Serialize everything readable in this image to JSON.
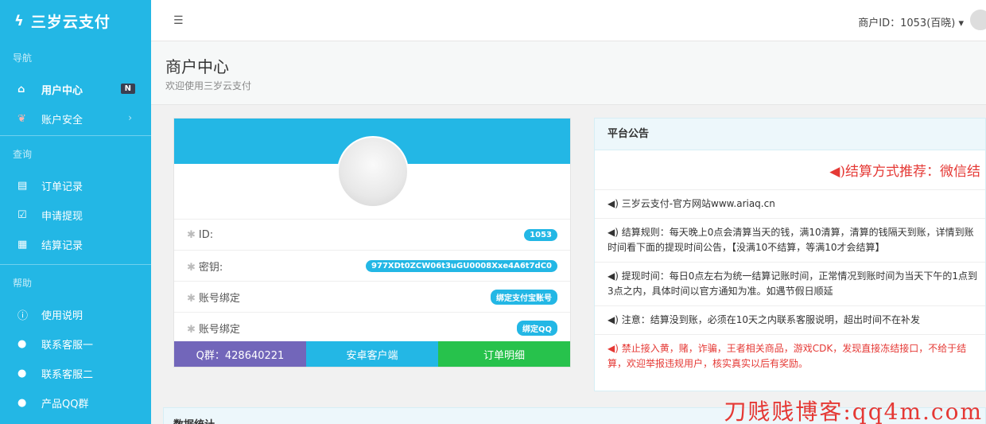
{
  "brand": {
    "name": "三岁云支付",
    "icon": "bolt-icon"
  },
  "sidebar": {
    "sections": [
      {
        "title": "导航"
      },
      {
        "title": "查询"
      },
      {
        "title": "帮助"
      }
    ],
    "nav": [
      {
        "label": "用户中心",
        "icon": "home-icon",
        "badge": "N"
      },
      {
        "label": "账户安全",
        "icon": "leaf-icon"
      },
      {
        "label": "订单记录",
        "icon": "list-icon"
      },
      {
        "label": "申请提现",
        "icon": "check-square-icon"
      },
      {
        "label": "结算记录",
        "icon": "grid-icon"
      },
      {
        "label": "使用说明",
        "icon": "info-icon"
      },
      {
        "label": "联系客服一",
        "icon": "user-icon"
      },
      {
        "label": "联系客服二",
        "icon": "user-icon"
      },
      {
        "label": "产品QQ群",
        "icon": "user-icon"
      }
    ]
  },
  "header": {
    "user_label": "商户ID：1053(百晓) ▾"
  },
  "page": {
    "title": "商户中心",
    "subtitle": "欢迎使用三岁云支付"
  },
  "profile": {
    "rows": [
      {
        "label": "ID:",
        "value": "1053"
      },
      {
        "label": "密钥:",
        "value": "977XDt0ZCW06t3uGU0008Xxe4A6t7dC0"
      },
      {
        "label": "账号绑定",
        "value": "绑定支付宝账号"
      },
      {
        "label": "账号绑定",
        "value": "绑定QQ"
      }
    ],
    "buttons": {
      "qq_group": "Q群：428640221",
      "android": "安卓客户端",
      "orders": "订单明细"
    }
  },
  "notice": {
    "title": "平台公告",
    "banner": "◀)结算方式推荐：微信结",
    "items": [
      "◀) 三岁云支付-官方网站www.ariaq.cn",
      "◀) 结算规则：每天晚上0点会清算当天的钱，满10清算，清算的钱隔天到账，详情到账时间看下面的提现时间公告，【没满10不结算，等满10才会结算】",
      "◀) 提现时间：每日0点左右为统一结算记账时间，正常情况到账时间为当天下午的1点到3点之内，具体时间以官方通知为准。如遇节假日顺延",
      "◀) 注意：结算没到账，必须在10天之内联系客服说明，超出时间不在补发",
      "◀) 禁止接入黄，赌，诈骗，王者相关商品，游戏CDK，发现直接冻结接口，不给于结算，欢迎举报违规用户，核实真实以后有奖励。"
    ]
  },
  "stats": {
    "title": "数据统计"
  },
  "watermark": "刀贱贱博客:qq4m.com",
  "colors": {
    "accent": "#23b7e5",
    "purple": "#7266ba",
    "green": "#27c24c",
    "red": "#e53935"
  }
}
